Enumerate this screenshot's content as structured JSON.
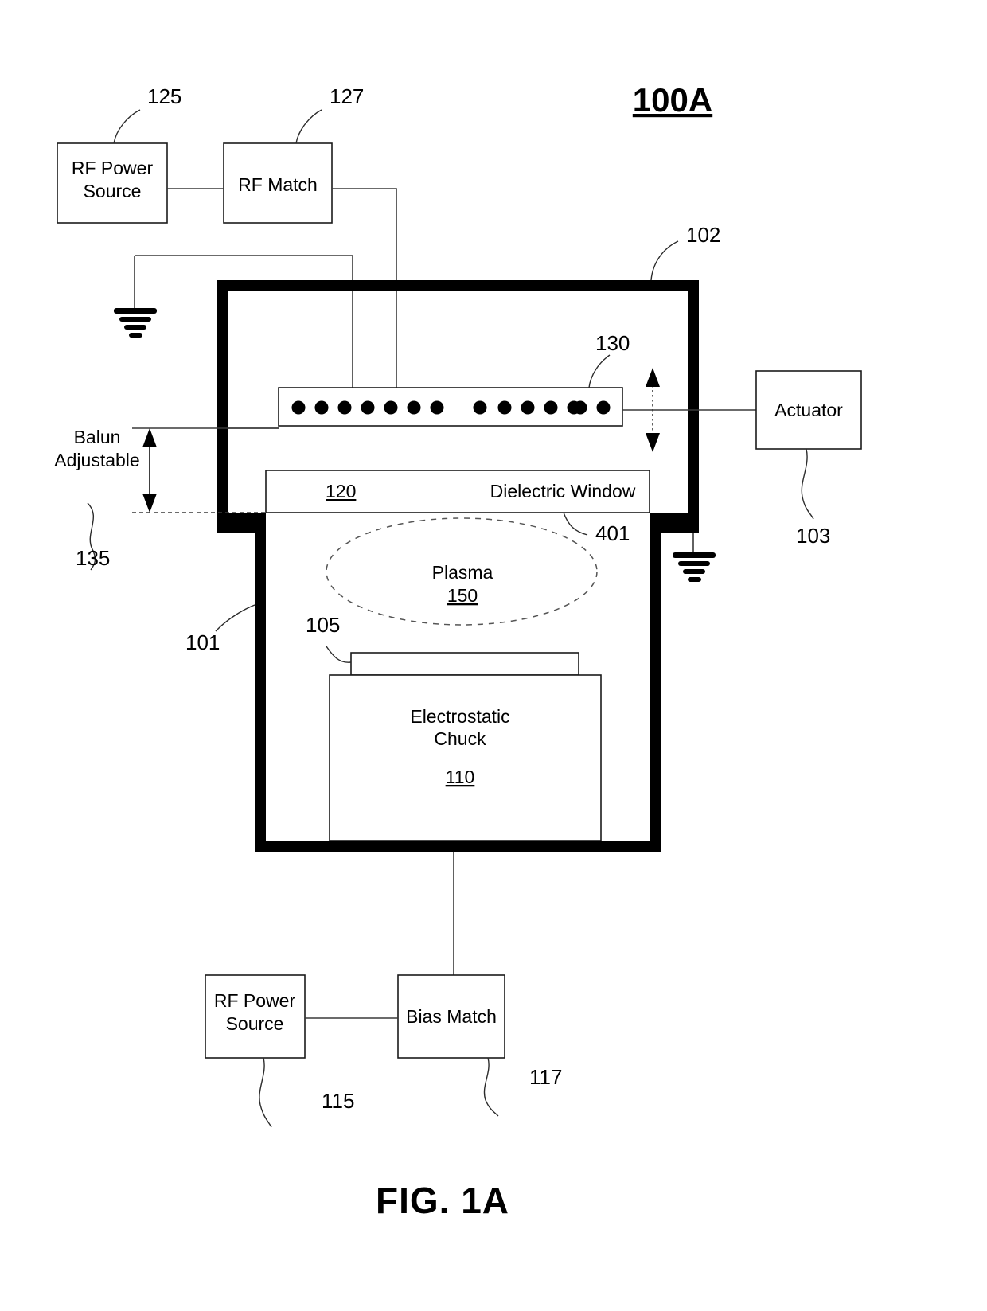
{
  "figure": {
    "title": "100A",
    "caption": "FIG. 1A"
  },
  "blocks": {
    "rf_power_source_top": "RF Power\nSource",
    "rf_power_source_top_line1": "RF Power",
    "rf_power_source_top_line2": "Source",
    "rf_match": "RF Match",
    "actuator": "Actuator",
    "dielectric_window_label": "Dielectric Window",
    "dielectric_window_ref": "120",
    "plasma_label": "Plasma",
    "plasma_ref": "150",
    "esc_line1": "Electrostatic",
    "esc_line2": "Chuck",
    "esc_ref": "110",
    "rf_power_source_bottom_line1": "RF Power",
    "rf_power_source_bottom_line2": "Source",
    "bias_match": "Bias Match",
    "balun_line1": "Balun",
    "balun_line2": "Adjustable"
  },
  "refs": {
    "r125": "125",
    "r127": "127",
    "r102": "102",
    "r130": "130",
    "r103": "103",
    "r135": "135",
    "r401": "401",
    "r101": "101",
    "r105": "105",
    "r115": "115",
    "r117": "117"
  },
  "coil": {
    "dot_count": 14,
    "dots_left_group": 7,
    "dots_right_group": 7
  },
  "colors": {
    "line": "#1a1a1a",
    "wall": "#000000",
    "wire": "#3a3a3a",
    "background": "#ffffff"
  }
}
